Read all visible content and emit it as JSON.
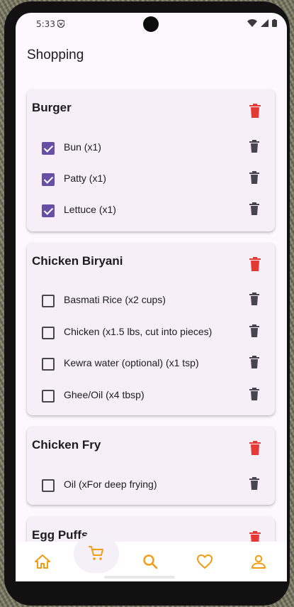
{
  "status_bar": {
    "time": "5:33"
  },
  "app": {
    "title": "Shopping"
  },
  "recipes": [
    {
      "name": "Burger",
      "items": [
        {
          "label": "Bun (x1)",
          "checked": true
        },
        {
          "label": "Patty (x1)",
          "checked": true
        },
        {
          "label": "Lettuce (x1)",
          "checked": true
        }
      ]
    },
    {
      "name": "Chicken Biryani",
      "items": [
        {
          "label": "Basmati Rice (x2 cups)",
          "checked": false
        },
        {
          "label": "Chicken (x1.5 lbs, cut into pieces)",
          "checked": false
        },
        {
          "label": "Kewra water (optional) (x1 tsp)",
          "checked": false
        },
        {
          "label": "Ghee/Oil (x4 tbsp)",
          "checked": false
        }
      ]
    },
    {
      "name": "Chicken Fry",
      "items": [
        {
          "label": "Oil (xFor deep frying)",
          "checked": false
        }
      ]
    },
    {
      "name": "Egg Puffs",
      "items": []
    }
  ],
  "nav": {
    "items": [
      {
        "name": "home",
        "icon": "home-icon"
      },
      {
        "name": "cart",
        "icon": "cart-icon",
        "active": true
      },
      {
        "name": "search",
        "icon": "search-icon"
      },
      {
        "name": "favorites",
        "icon": "heart-icon"
      },
      {
        "name": "profile",
        "icon": "person-icon"
      }
    ]
  },
  "colors": {
    "accent": "#f39c12",
    "delete_red": "#e53935",
    "delete_dark": "#49454f",
    "checkbox_checked": "#6750a4",
    "card_bg": "#f6eff7"
  }
}
